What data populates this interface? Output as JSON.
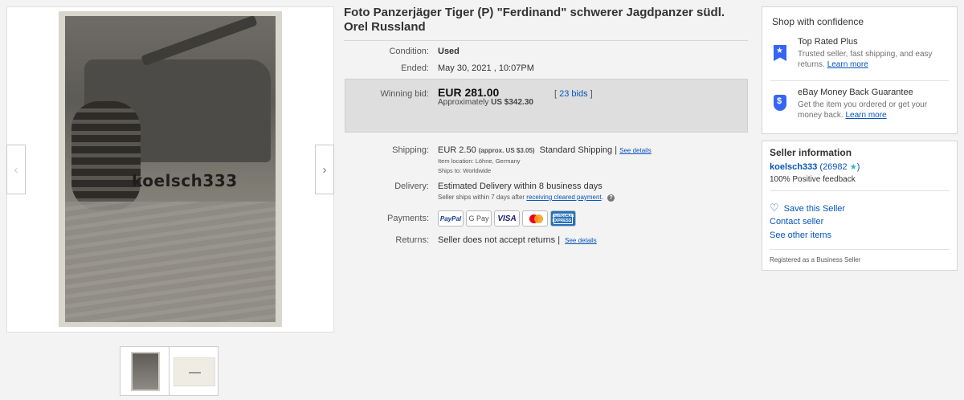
{
  "gallery": {
    "watermark": "koelsch333",
    "prev_arrow": "‹",
    "next_arrow": "›"
  },
  "item": {
    "title": "Foto Panzerjäger Tiger (P) \"Ferdinand\" schwerer Jagdpanzer südl. Orel Russland",
    "condition_label": "Condition:",
    "condition_value": "Used",
    "ended_label": "Ended:",
    "ended_value": "May 30, 2021 , 10:07PM",
    "winning_bid_label": "Winning bid:",
    "winning_bid_value": "EUR 281.00",
    "approx_prefix": "Approximately",
    "approx_value": "US $342.30",
    "bids_link": "23 bids",
    "shipping_label": "Shipping:",
    "shipping_value": "EUR 2.50",
    "shipping_approx": "(approx. US $3.05)",
    "shipping_method": "Standard Shipping |",
    "see_details": "See details",
    "item_location": "Item location:  Löhne, Germany",
    "ships_to": "Ships to:  Worldwide",
    "delivery_label": "Delivery:",
    "delivery_value": "Estimated Delivery within 8 business days",
    "delivery_note": "Seller ships within 7 days after",
    "delivery_note_link": "receiving cleared payment",
    "payments_label": "Payments:",
    "payment_methods": [
      "PayPal",
      "G Pay",
      "VISA",
      "",
      "AMERICAN EXPRESS"
    ],
    "returns_label": "Returns:",
    "returns_value": "Seller does not accept returns |",
    "returns_see_details": "See details"
  },
  "confidence": {
    "heading": "Shop with confidence",
    "top_rated_title": "Top Rated Plus",
    "top_rated_desc": "Trusted seller, fast shipping, and easy returns.",
    "top_rated_link": "Learn more",
    "guarantee_title": "eBay Money Back Guarantee",
    "guarantee_desc": "Get the item you ordered or get your money back.",
    "guarantee_link": "Learn more"
  },
  "seller": {
    "heading": "Seller information",
    "name": "koelsch333",
    "feedback_count": "26982",
    "feedback_percent": "100% Positive feedback",
    "save_seller": "Save this Seller",
    "contact_seller": "Contact seller",
    "see_other_items": "See other items",
    "registered": "Registered as a Business Seller"
  }
}
